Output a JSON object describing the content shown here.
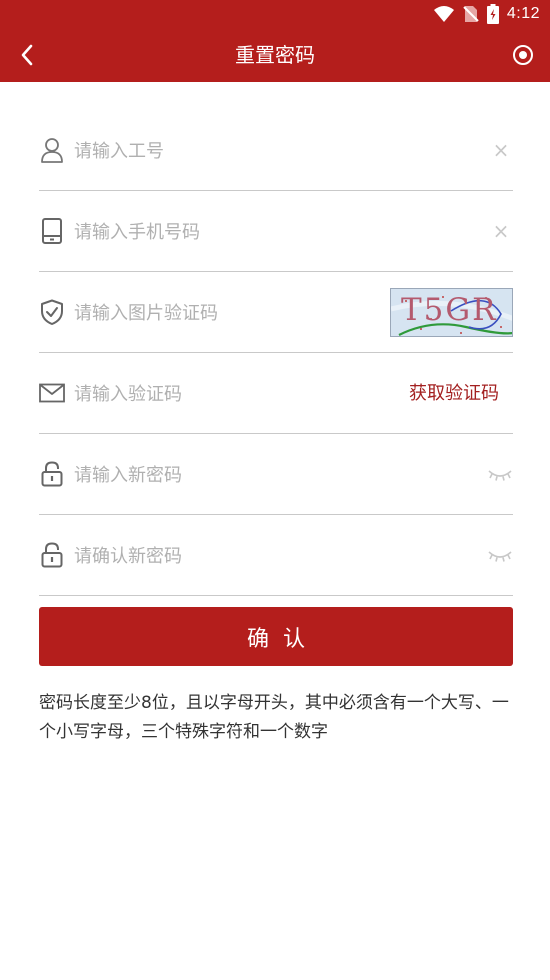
{
  "status_bar": {
    "time": "4:12",
    "icons": [
      "wifi-icon",
      "no-sim-icon",
      "battery-icon"
    ]
  },
  "app_bar": {
    "title": "重置密码",
    "back_icon": "chevron-left-icon",
    "action_icon": "target-icon",
    "background_color": "#b41e1c"
  },
  "form": {
    "employee_id": {
      "placeholder": "请输入工号",
      "icon": "user-icon",
      "clear": "×"
    },
    "phone": {
      "placeholder": "请输入手机号码",
      "icon": "phone-icon",
      "clear": "×"
    },
    "captcha": {
      "placeholder": "请输入图片验证码",
      "icon": "shield-check-icon",
      "image_text": "T5GR"
    },
    "sms_code": {
      "placeholder": "请输入验证码",
      "icon": "mail-icon",
      "get_code_label": "获取验证码"
    },
    "new_password": {
      "placeholder": "请输入新密码",
      "icon": "lock-icon",
      "toggle_icon": "eye-closed-icon"
    },
    "confirm_password": {
      "placeholder": "请确认新密码",
      "icon": "lock-icon",
      "toggle_icon": "eye-closed-icon"
    }
  },
  "confirm_button": {
    "label": "确认"
  },
  "hint": "密码长度至少8位，且以字母开头，其中必须含有一个大写、一个小写字母，三个特殊字符和一个数字"
}
